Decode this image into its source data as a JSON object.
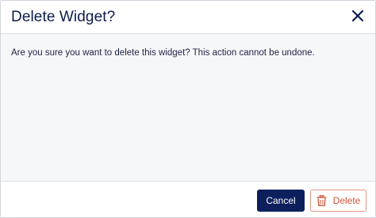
{
  "dialog": {
    "title": "Delete Widget?",
    "message": "Are you sure you want to delete this widget? This action cannot be undone.",
    "cancel_label": "Cancel",
    "delete_label": "Delete"
  },
  "icons": {
    "close": "close-icon",
    "trash": "trash-icon"
  },
  "colors": {
    "title_text": "#0d1b4a",
    "primary_button": "#0d1f5c",
    "danger_text": "#d0533a",
    "danger_border": "#e39484",
    "body_background": "#f6f7f9"
  }
}
